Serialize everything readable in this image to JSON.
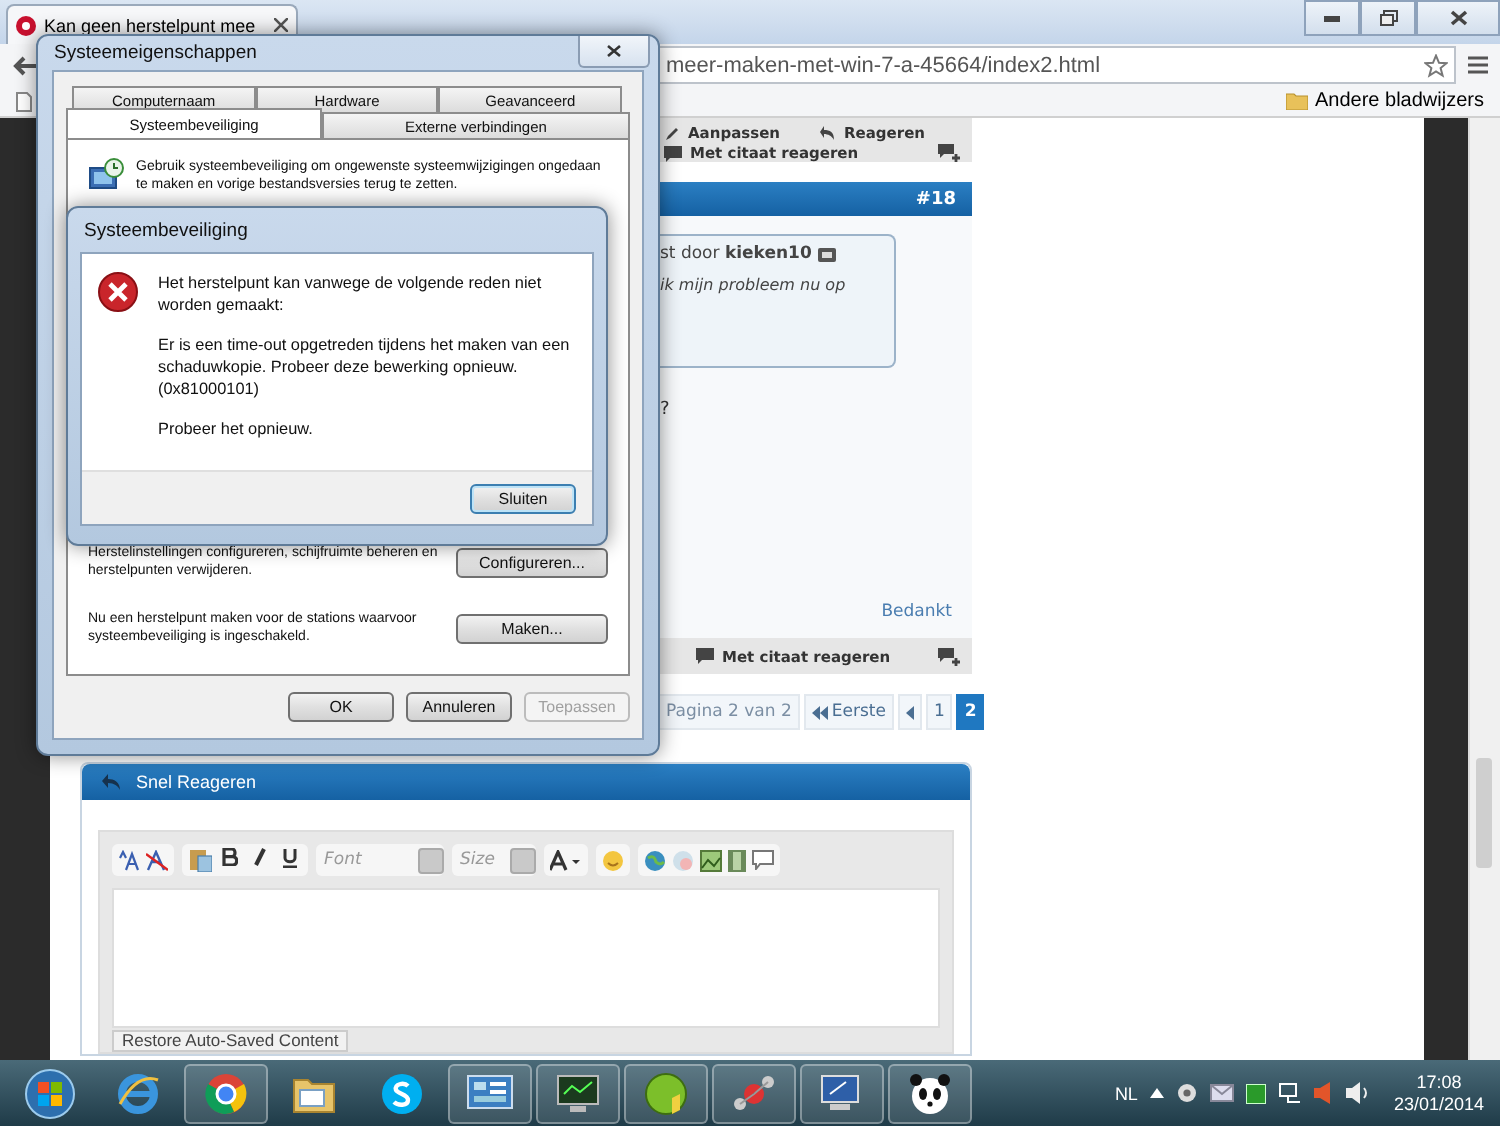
{
  "browser": {
    "tab_title": "Kan geen herstelpunt mee",
    "url": "meer-maken-met-win-7-a-45664/index2.html",
    "bookmark_folder": "Andere bladwijzers"
  },
  "forum": {
    "top_actions": [
      "Aanpassen",
      "Reageren"
    ],
    "top_quote": "Met citaat reageren",
    "post": {
      "number": "#18",
      "quote_prefix": "st door",
      "quote_author": "kieken10",
      "quote_text": "ik mijn probleem nu op",
      "body": "?",
      "thanks": "Bedankt",
      "quote_button": "Met citaat reageren"
    },
    "pagination": {
      "label": "Pagina 2 van 2",
      "first": "Eerste",
      "pages": [
        {
          "label": "1",
          "selected": false
        },
        {
          "label": "2",
          "selected": true
        }
      ]
    },
    "quick_reply": {
      "title": "Snel Reageren",
      "font_placeholder": "Font",
      "size_placeholder": "Size",
      "restore": "Restore Auto-Saved Content"
    }
  },
  "system_properties": {
    "title": "Systeemeigenschappen",
    "tab_rows": [
      {
        "tabs": [
          {
            "label": "Computernaam",
            "selected": false
          },
          {
            "label": "Hardware",
            "selected": false
          },
          {
            "label": "Geavanceerd",
            "selected": false
          }
        ]
      },
      {
        "tabs": [
          {
            "label": "Systeembeveiliging",
            "selected": true
          },
          {
            "label": "Externe verbindingen",
            "selected": false
          }
        ]
      }
    ],
    "intro": "Gebruik systeembeveiliging om ongewenste systeemwijzigingen ongedaan te maken en vorige bestandsversies terug te zetten.",
    "sections": [
      {
        "text": "Herstelinstellingen configureren, schijfruimte beheren en herstelpunten verwijderen.",
        "button": "Configureren..."
      },
      {
        "text": "Nu een herstelpunt maken voor de stations waarvoor systeembeveiliging is ingeschakeld.",
        "button": "Maken..."
      }
    ],
    "buttons": [
      {
        "label": "OK",
        "disabled": false
      },
      {
        "label": "Annuleren",
        "disabled": false
      },
      {
        "label": "Toepassen",
        "disabled": true
      }
    ]
  },
  "error_dialog": {
    "title": "Systeembeveiliging",
    "heading": "Het herstelpunt kan vanwege de volgende reden niet worden gemaakt:",
    "detail": "Er is een time-out opgetreden tijdens het maken van een schaduwkopie. Probeer deze bewerking opnieuw.",
    "code": "(0x81000101)",
    "retry": "Probeer het opnieuw.",
    "button": "Sluiten"
  },
  "taskbar": {
    "buttons": [
      {
        "running": false
      },
      {
        "running": false
      },
      {
        "running": true
      },
      {
        "running": false
      },
      {
        "running": false
      },
      {
        "running": true
      },
      {
        "running": true
      },
      {
        "running": true
      },
      {
        "running": true
      },
      {
        "running": true
      },
      {
        "running": true
      }
    ],
    "language": "NL",
    "time": "17:08",
    "date": "23/01/2014"
  }
}
